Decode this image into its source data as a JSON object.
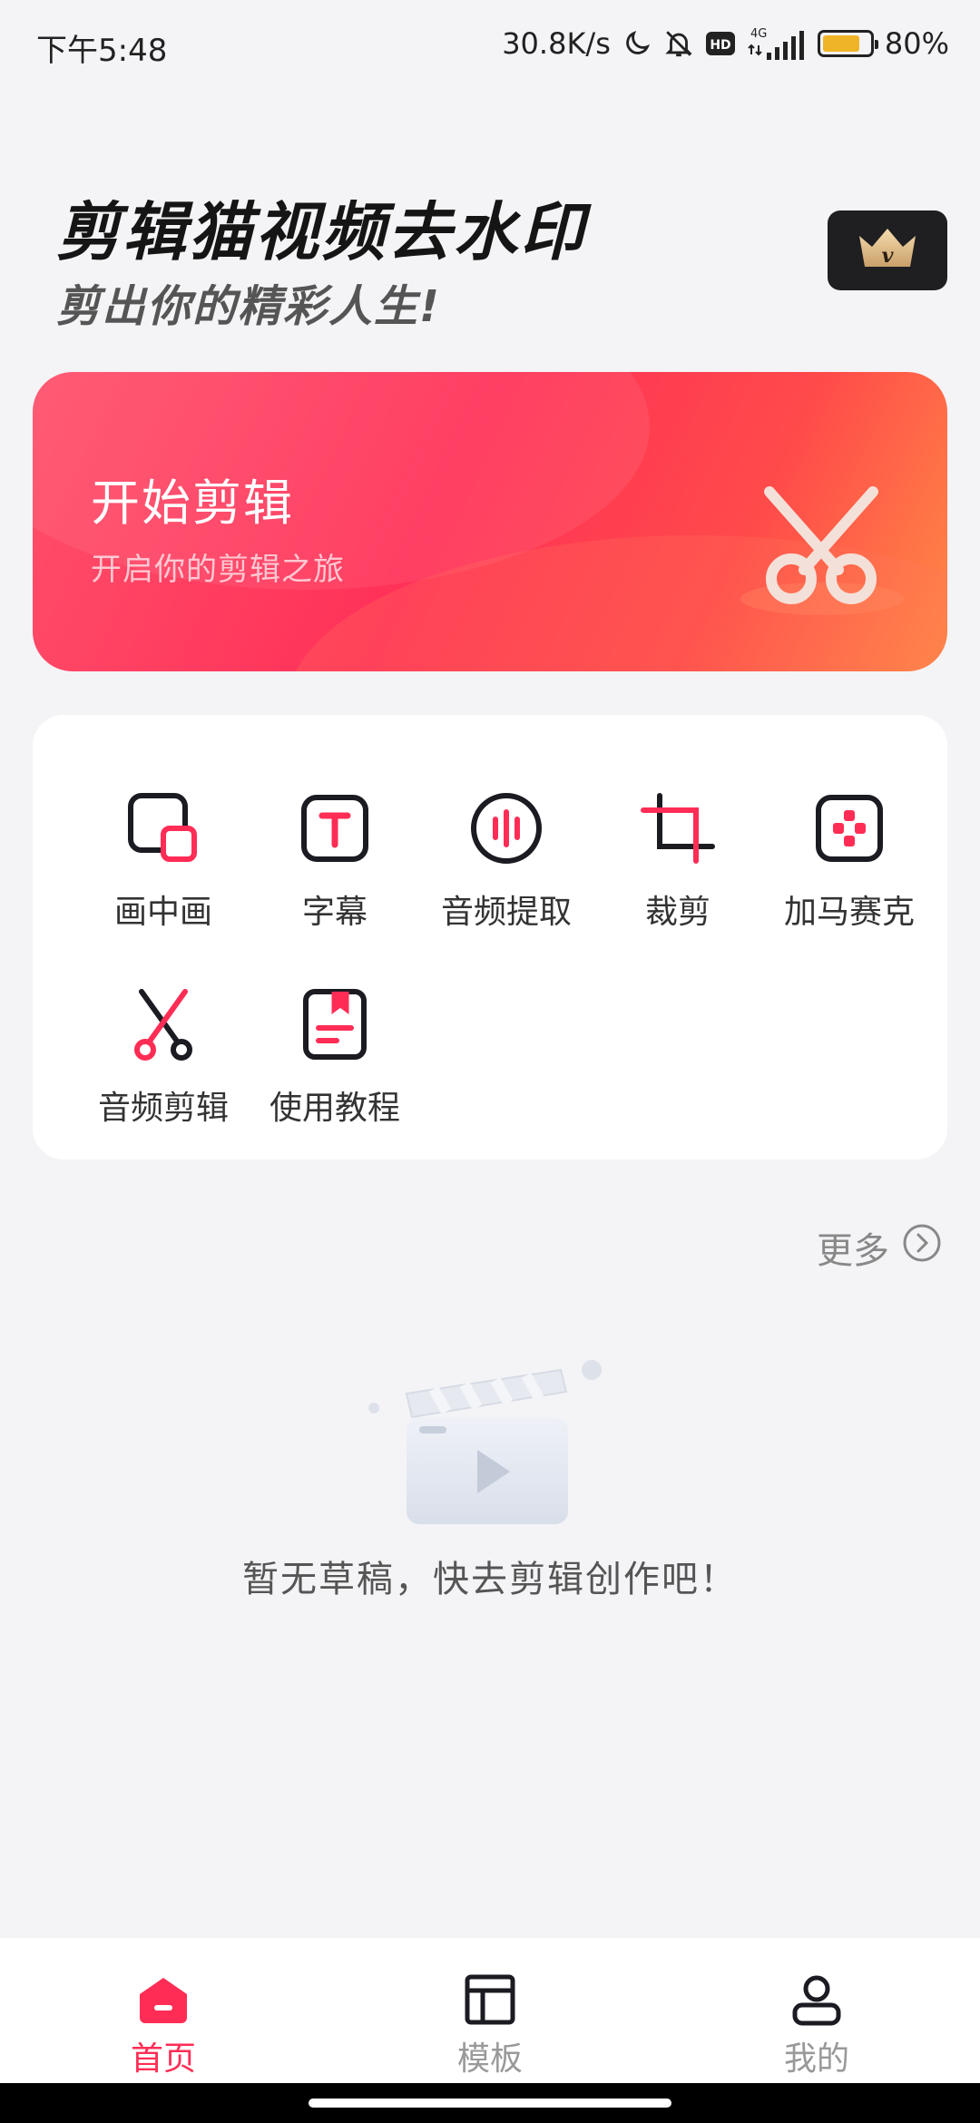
{
  "status_bar": {
    "time": "下午5:48",
    "network_speed": "30.8K/s",
    "network_type": "4G",
    "hd_badge": "HD",
    "battery_level": 0.8,
    "battery_text": "80%",
    "icons": [
      "moon-icon",
      "bell-off-icon",
      "hd-icon",
      "signal-icon",
      "battery-icon"
    ]
  },
  "header": {
    "title": "剪辑猫视频去水印",
    "slogan": "剪出你的精彩人生!",
    "vip_icon": "crown-icon"
  },
  "hero": {
    "title": "开始剪辑",
    "subtitle": "开启你的剪辑之旅",
    "icon": "scissors-icon"
  },
  "tools": [
    {
      "label": "画中画",
      "icon": "pip-icon"
    },
    {
      "label": "字幕",
      "icon": "subtitle-icon"
    },
    {
      "label": "音频提取",
      "icon": "audio-extract-icon"
    },
    {
      "label": "裁剪",
      "icon": "crop-icon"
    },
    {
      "label": "加马赛克",
      "icon": "mosaic-icon"
    },
    {
      "label": "音频剪辑",
      "icon": "audio-cut-icon"
    },
    {
      "label": "使用教程",
      "icon": "tutorial-icon"
    }
  ],
  "drafts": {
    "more_label": "更多",
    "empty_text": "暂无草稿，快去剪辑创作吧！"
  },
  "bottom_nav": [
    {
      "label": "首页",
      "icon": "home-icon",
      "active": true
    },
    {
      "label": "模板",
      "icon": "template-icon",
      "active": false
    },
    {
      "label": "我的",
      "icon": "profile-icon",
      "active": false
    }
  ],
  "colors": {
    "accent": "#ff2d55",
    "dark": "#1b1b22",
    "battery": "#f0b429"
  }
}
